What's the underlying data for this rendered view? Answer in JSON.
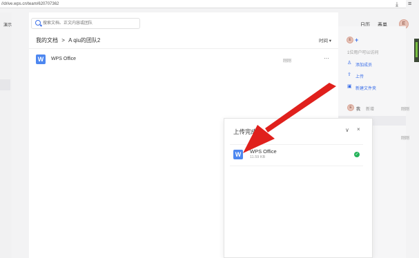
{
  "browser": {
    "url": "//drive.wps.cn/team/620707362"
  },
  "left_nav": {
    "label": "演示"
  },
  "search": {
    "placeholder": "搜索文档、正文内容或团队"
  },
  "breadcrumb": {
    "root": "我的文档",
    "separator": ">",
    "current": "A qiu的团队2"
  },
  "list": {
    "sort_label": "时间 ▾",
    "files": [
      {
        "name": "WPS Office",
        "time": "刚刚",
        "more": "···",
        "icon": "W"
      }
    ]
  },
  "header_right": {
    "calendar": "日历",
    "forms": "表单",
    "avatar_initial": "E"
  },
  "team_panel": {
    "avatar_initial": "E",
    "member_count": "1位用户可以访问",
    "actions": [
      {
        "label": "添加成员",
        "icon": "add-user-icon"
      },
      {
        "label": "上传",
        "icon": "upload-icon"
      },
      {
        "label": "新建文件夹",
        "icon": "new-folder-icon"
      }
    ],
    "activity": {
      "user": "我",
      "action": "新增",
      "time": "刚刚",
      "file_fragment": "ce"
    }
  },
  "upload_dialog": {
    "title": "上传完成",
    "collapse": "∨",
    "close": "×",
    "file": {
      "name": "WPS Office",
      "size": "11.59 KB",
      "icon": "W"
    },
    "status_icon": "✓"
  },
  "colors": {
    "accent": "#3a6ee8",
    "wps_icon": "#4d87f0",
    "success": "#25b35a",
    "arrow": "#e0201c"
  }
}
